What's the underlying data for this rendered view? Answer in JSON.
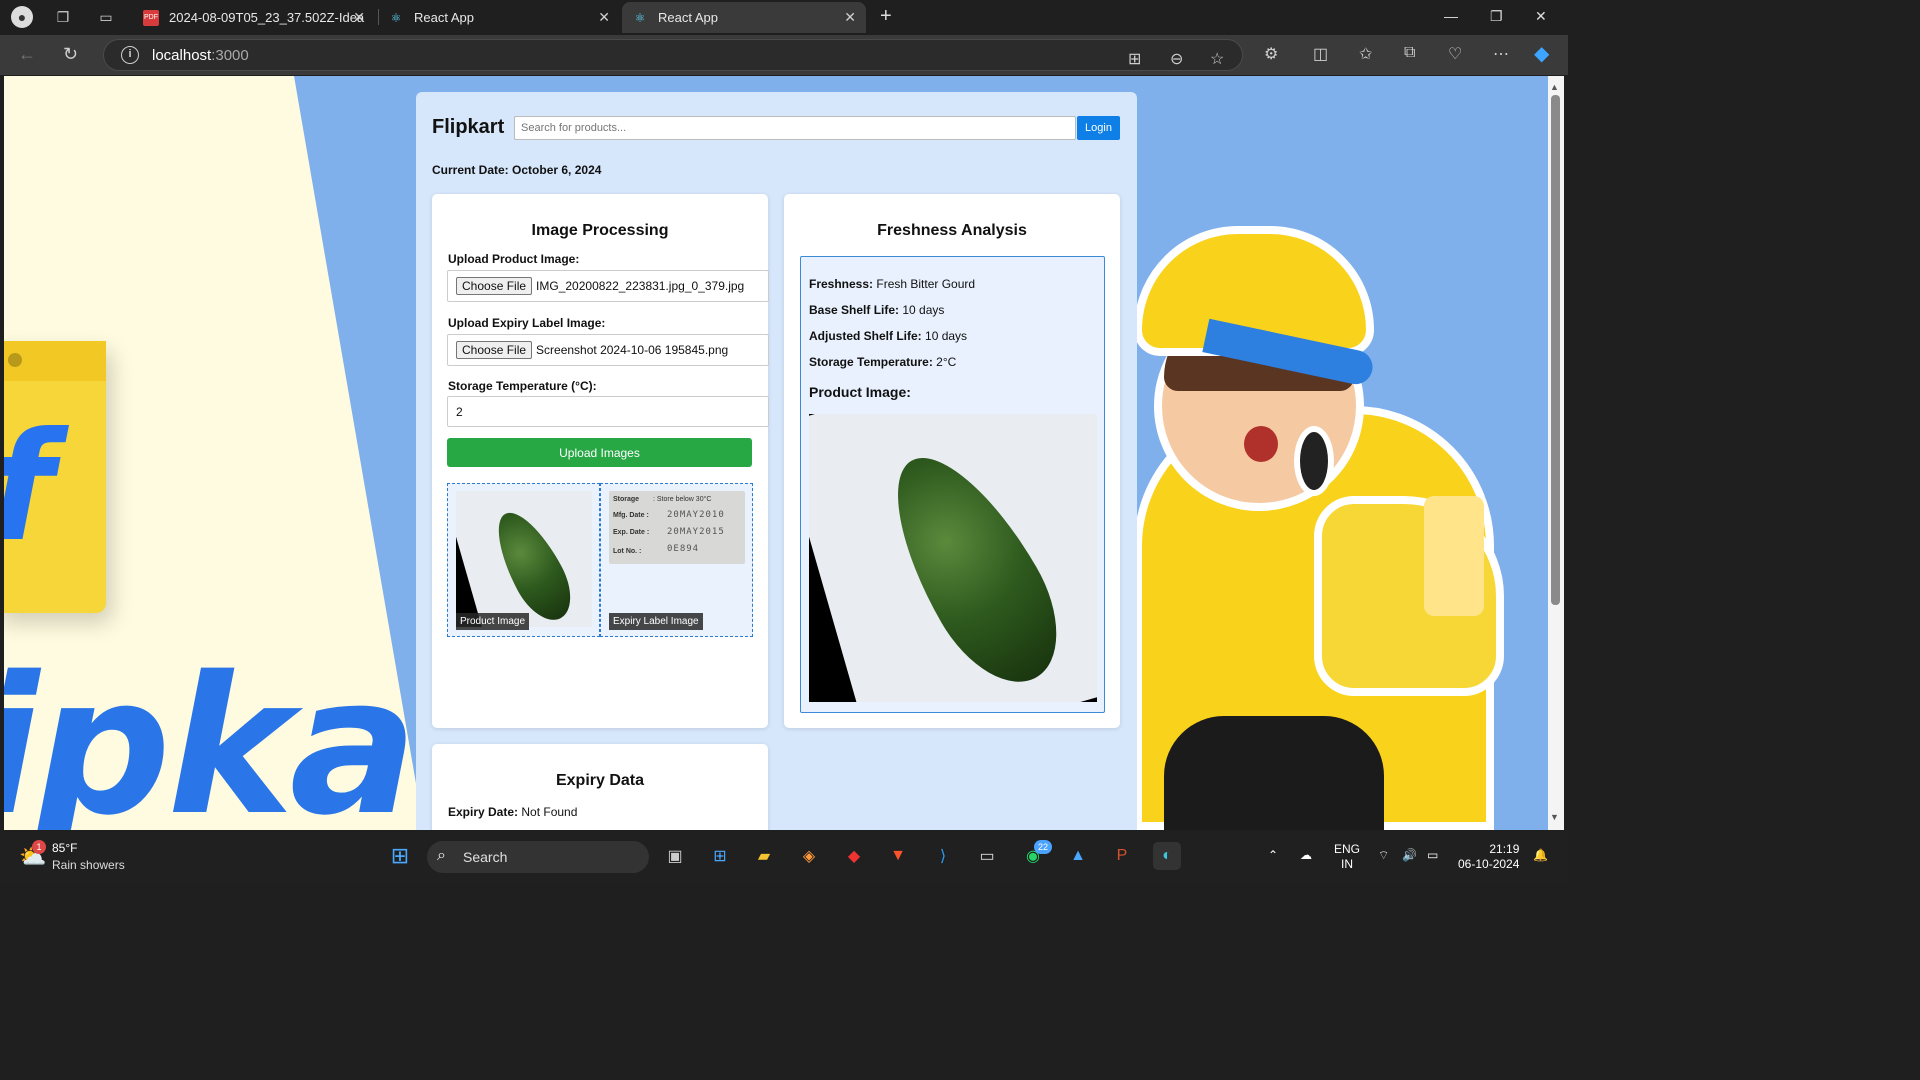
{
  "browser": {
    "tabs": [
      {
        "title": "2024-08-09T05_23_37.502Z-Idea",
        "icon": "pdf-icon",
        "active": false
      },
      {
        "title": "React App",
        "icon": "react-icon",
        "active": false
      },
      {
        "title": "React App",
        "icon": "react-icon",
        "active": true
      }
    ],
    "url_host": "localhost",
    "url_port": ":3000"
  },
  "header": {
    "brand": "Flipkart",
    "search_placeholder": "Search for products...",
    "login_label": "Login"
  },
  "current_date": {
    "label": "Current Date:",
    "value": "October 6, 2024"
  },
  "image_processing": {
    "title": "Image Processing",
    "product_label": "Upload Product Image:",
    "product_file": "IMG_20200822_223831.jpg_0_379.jpg",
    "expiry_label": "Upload Expiry Label Image:",
    "expiry_file": "Screenshot 2024-10-06 195845.png",
    "choose_file": "Choose File",
    "temp_label": "Storage Temperature (°C):",
    "temp_value": "2",
    "upload_button": "Upload Images",
    "thumb_product_caption": "Product Image",
    "thumb_expiry_caption": "Expiry Label Image",
    "label_text": {
      "storage_key": "Storage",
      "storage_val": ": Store below 30°C",
      "mfg_key": "Mfg. Date :",
      "mfg_val": "20MAY2010",
      "exp_key": "Exp. Date :",
      "exp_val": "20MAY2015",
      "lot_key": "Lot No.   :",
      "lot_val": "0E894"
    }
  },
  "freshness": {
    "title": "Freshness Analysis",
    "freshness_key": "Freshness:",
    "freshness_val": "Fresh Bitter Gourd",
    "base_key": "Base Shelf Life:",
    "base_val": "10 days",
    "adjusted_key": "Adjusted Shelf Life:",
    "adjusted_val": "10 days",
    "storage_key": "Storage Temperature:",
    "storage_val": "2°C",
    "product_image_heading": "Product Image:"
  },
  "expiry": {
    "title": "Expiry Data",
    "date_key": "Expiry Date:",
    "date_val": "Not Found"
  },
  "taskbar": {
    "weather_temp": "85°F",
    "weather_desc": "Rain showers",
    "weather_badge": "1",
    "search_label": "Search",
    "whatsapp_badge": "22",
    "lang_top": "ENG",
    "lang_bottom": "IN",
    "time": "21:19",
    "date": "06-10-2024"
  }
}
